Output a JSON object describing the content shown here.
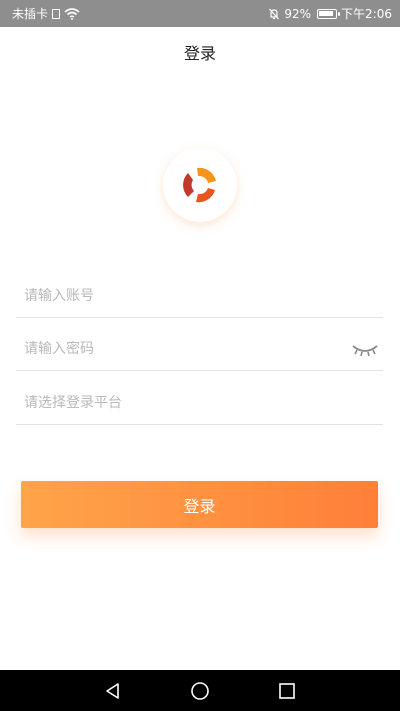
{
  "status_bar": {
    "carrier": "未插卡",
    "battery": "92%",
    "battery_level": 0.92,
    "time": "下午2:06"
  },
  "header": {
    "title": "登录"
  },
  "form": {
    "account_placeholder": "请输入账号",
    "password_placeholder": "请输入密码",
    "platform_placeholder": "请选择登录平台"
  },
  "login_button": {
    "label": "登录"
  },
  "colors": {
    "accent_start": "#ffa449",
    "accent_end": "#ff7f39",
    "status_bar": "#8e8e8e"
  },
  "icons": {
    "logo": "swirl-logo-icon",
    "password_toggle": "eye-closed-icon",
    "nav_back": "triangle-back-icon",
    "nav_home": "circle-home-icon",
    "nav_recent": "square-recent-icon"
  }
}
